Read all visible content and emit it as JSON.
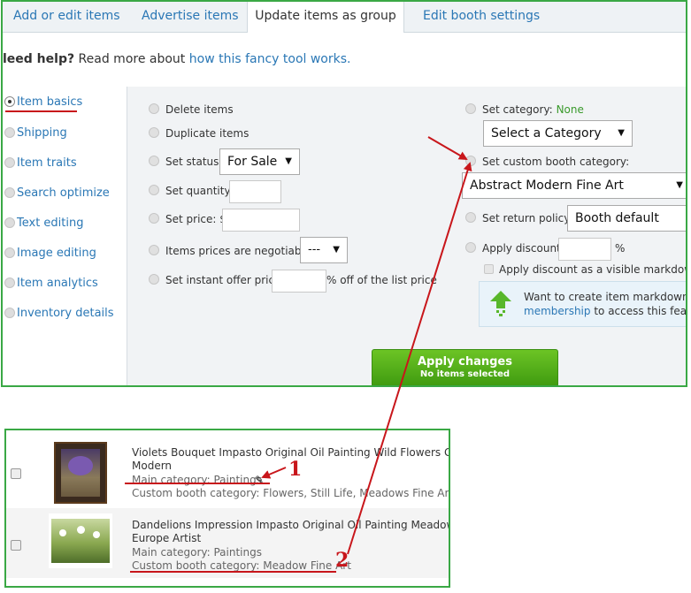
{
  "tabs": [
    "Add or edit items",
    "Advertise items",
    "Update items as group",
    "Edit booth settings"
  ],
  "help": {
    "bold": "leed help?",
    "text": "Read more about",
    "link": "how this fancy tool works."
  },
  "sidebar": [
    "Item basics",
    "Shipping",
    "Item traits",
    "Search optimize",
    "Text editing",
    "Image editing",
    "Item analytics",
    "Inventory details"
  ],
  "options_left": {
    "delete": "Delete items",
    "duplicate": "Duplicate items",
    "set_status": "Set status:",
    "status_value": "For Sale",
    "set_quantity": "Set quantity:",
    "set_price": "Set price: $",
    "negotiable": "Items prices are negotiable:",
    "negotiable_value": "---",
    "instant_offer": "Set instant offer price:",
    "instant_offer_suffix": "% off of the list price"
  },
  "options_right": {
    "set_category": "Set category:",
    "category_value": "None",
    "select_category": "Select a Category",
    "custom_booth": "Set custom booth category:",
    "custom_booth_value": "Abstract Modern Fine Art",
    "return_policy": "Set return policy:",
    "return_policy_value": "Booth default",
    "apply_discount": "Apply discount:",
    "percent": "%",
    "visible_markdown": "Apply discount as a visible markdown. Le",
    "info_text": "Want to create item markdowns? U",
    "info_link": "membership",
    "info_suffix": "to access this feature."
  },
  "apply_button": {
    "label": "Apply changes",
    "sub": "No items selected"
  },
  "items": [
    {
      "title_line1": "Violets Bouquet Impasto Original Oil Painting Wild Flowers Glass A",
      "title_line2": "Modern",
      "main_category": "Main category: Paintings",
      "custom_category": "Custom booth category: Flowers, Still Life, Meadows Fine Art"
    },
    {
      "title_line1": "Dandelions Impression Impasto Original Oil Painting Meadow Flowe",
      "title_line2": "Europe Artist",
      "main_category": "Main category: Paintings",
      "custom_category": "Custom booth category: Meadow Fine Art"
    }
  ],
  "annotations": {
    "one": "1",
    "two": "2"
  },
  "colors": {
    "link": "#2a77b5",
    "green_border": "#3aa845",
    "annotation_red": "#c8161b",
    "button_green": "#4fae17"
  }
}
